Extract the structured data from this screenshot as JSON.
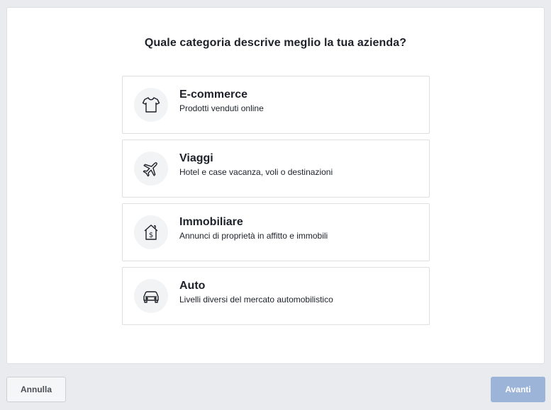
{
  "question": "Quale categoria descrive meglio la tua azienda?",
  "options": [
    {
      "title": "E-commerce",
      "description": "Prodotti venduti online",
      "icon": "tshirt-icon"
    },
    {
      "title": "Viaggi",
      "description": "Hotel e case vacanza, voli o destinazioni",
      "icon": "airplane-icon"
    },
    {
      "title": "Immobiliare",
      "description": "Annunci di proprietà in affitto e immobili",
      "icon": "house-dollar-icon"
    },
    {
      "title": "Auto",
      "description": "Livelli diversi del mercato automobilistico",
      "icon": "car-icon"
    }
  ],
  "footer": {
    "cancel_label": "Annulla",
    "next_label": "Avanti"
  },
  "colors": {
    "background": "#e9ebee",
    "text": "#1d2129",
    "icon_bg": "#f2f3f5",
    "next_disabled": "#9cb4d8"
  }
}
